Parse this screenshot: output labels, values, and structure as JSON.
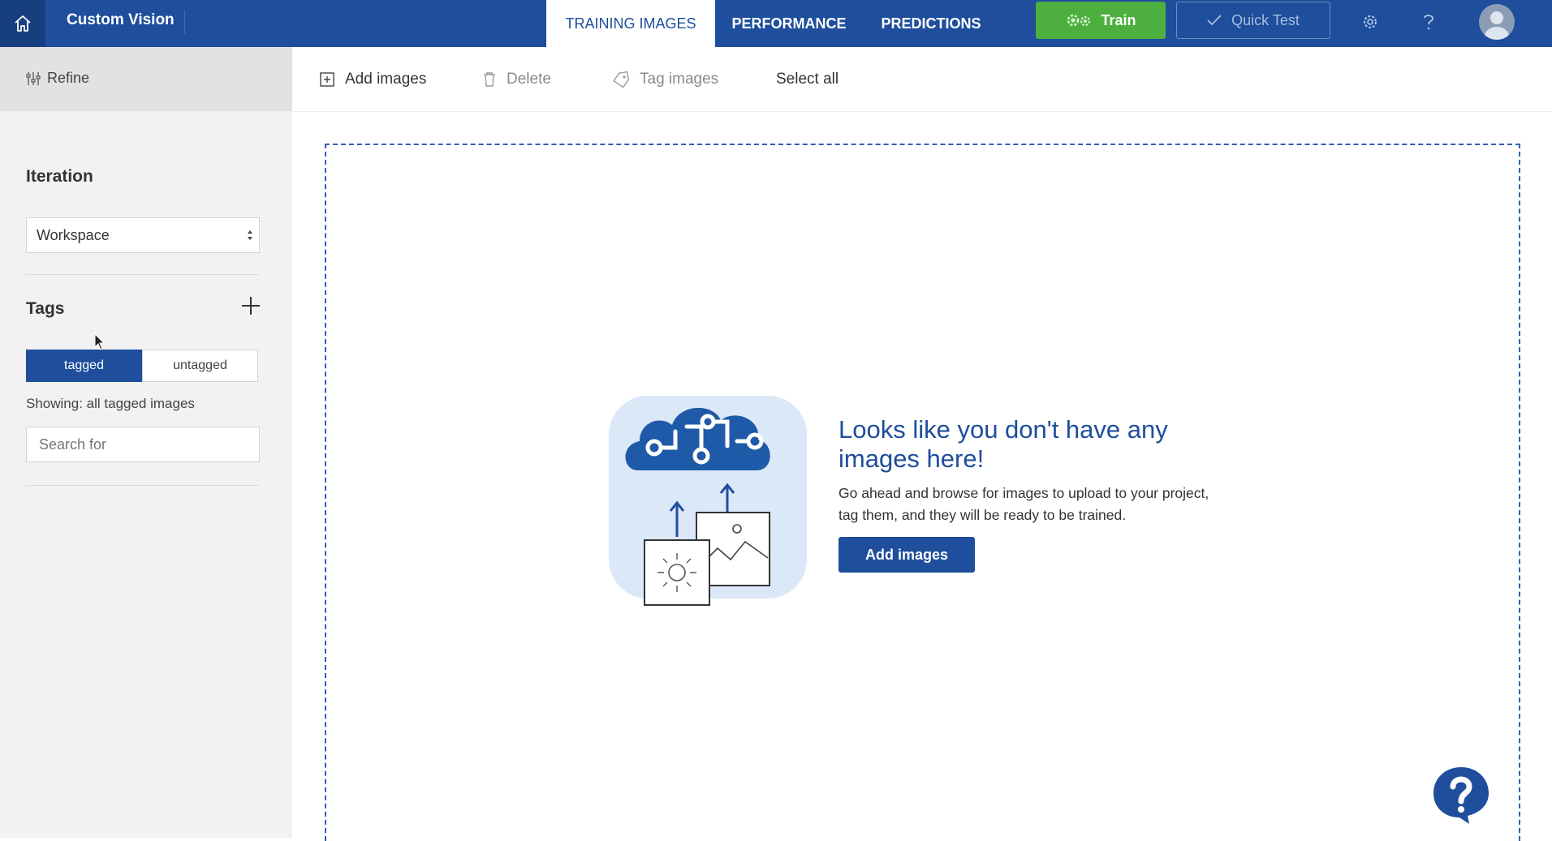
{
  "header": {
    "app_title": "Custom Vision",
    "tabs": [
      {
        "label": "TRAINING IMAGES",
        "active": true
      },
      {
        "label": "PERFORMANCE",
        "active": false
      },
      {
        "label": "PREDICTIONS",
        "active": false
      }
    ],
    "train_label": "Train",
    "quick_test_label": "Quick Test",
    "icons": [
      "home-icon",
      "gears-icon",
      "checkmark-icon",
      "settings-icon",
      "help-icon",
      "avatar-icon"
    ]
  },
  "sidebar": {
    "refine_label": "Refine",
    "iteration_label": "Iteration",
    "iteration_selected": "Workspace",
    "tags_label": "Tags",
    "filter": {
      "tagged": "tagged",
      "untagged": "untagged",
      "selected": "tagged"
    },
    "showing_text": "Showing: all tagged images",
    "search_placeholder": "Search for"
  },
  "toolbar": {
    "add_images": "Add images",
    "delete": "Delete",
    "tag_images": "Tag images",
    "select_all": "Select all"
  },
  "empty_state": {
    "title": "Looks like you don't have any images here!",
    "description": "Go ahead and browse for images to upload to your project, tag them, and they will be ready to be trained.",
    "button_label": "Add images"
  },
  "colors": {
    "header_bg": "#1e4e9c",
    "train_green": "#4caf3e",
    "accent_blue": "#1e4e9c",
    "sidebar_bg": "#f2f2f2"
  }
}
